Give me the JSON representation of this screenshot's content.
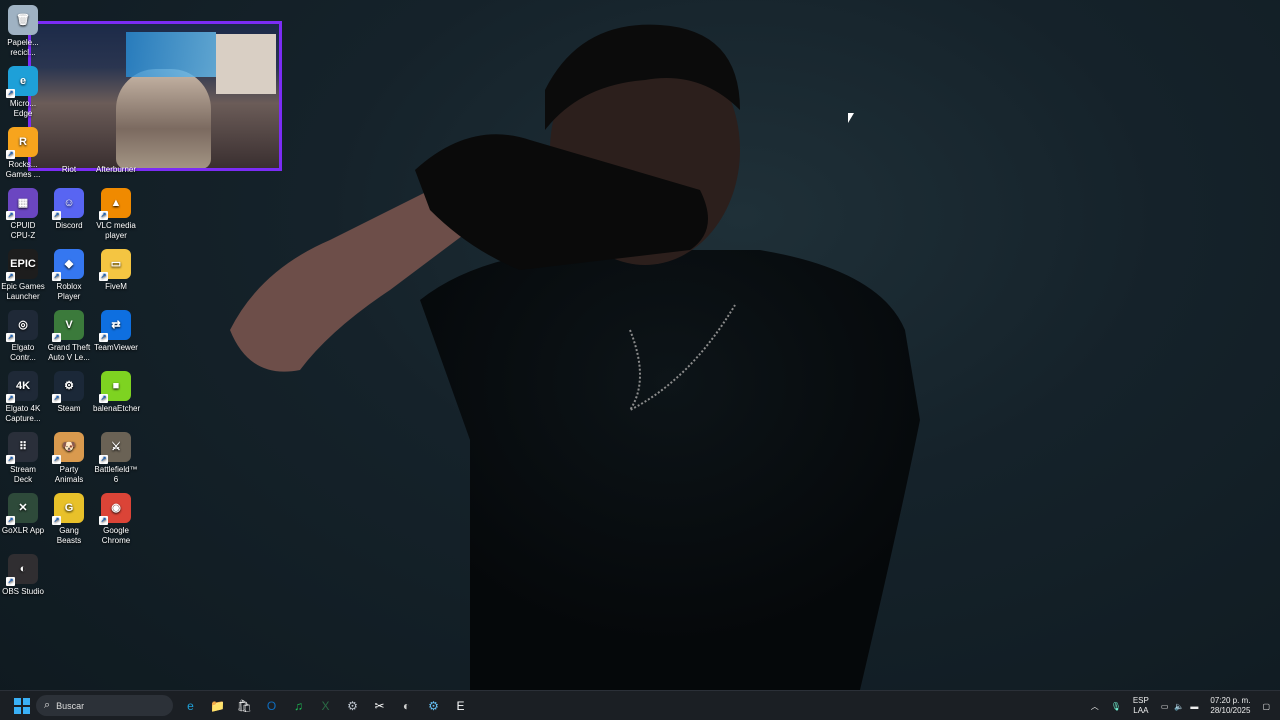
{
  "desktop_icons": [
    {
      "label": "Papelera de reciclaje",
      "display": "Papele... recicl...",
      "icon": "recycle-bin-icon",
      "color": "#9fb2c3"
    },
    {
      "label": "Microsoft Edge",
      "display": "Micro... Edge",
      "icon": "edge-icon",
      "color": "#1ea0d8"
    },
    {
      "label": "Rockstar Games",
      "display": "Rocks... Games ...",
      "icon": "rockstar-icon",
      "color": "#f7a41d"
    },
    {
      "label": "CPUID CPU-Z",
      "display": "CPUID CPU-Z",
      "icon": "cpu-icon",
      "color": "#6b46c1"
    },
    {
      "label": "Discord",
      "display": "Discord",
      "icon": "discord-icon",
      "color": "#5865f2"
    },
    {
      "label": "VLC media player",
      "display": "VLC media player",
      "icon": "vlc-icon",
      "color": "#f08a00"
    },
    {
      "label": "Epic Games Launcher",
      "display": "Epic Games Launcher",
      "icon": "epic-icon",
      "color": "#1d1d1d"
    },
    {
      "label": "Roblox Player",
      "display": "Roblox Player",
      "icon": "roblox-icon",
      "color": "#3577f0"
    },
    {
      "label": "FiveM",
      "display": "FiveM",
      "icon": "folder-icon",
      "color": "#f4c542"
    },
    {
      "label": "Elgato Control Center",
      "display": "Elgato Contr...",
      "icon": "elgato-icon",
      "color": "#1f2937"
    },
    {
      "label": "Grand Theft Auto V Legacy",
      "display": "Grand Theft Auto V Le...",
      "icon": "gta-icon",
      "color": "#3b7a3b"
    },
    {
      "label": "TeamViewer",
      "display": "TeamViewer",
      "icon": "teamviewer-icon",
      "color": "#0e6fe0"
    },
    {
      "label": "Elgato 4K Capture Utility",
      "display": "Elgato 4K Capture...",
      "icon": "4k-icon",
      "color": "#1f2937"
    },
    {
      "label": "Steam",
      "display": "Steam",
      "icon": "steam-icon",
      "color": "#1b2838"
    },
    {
      "label": "balenaEtcher",
      "display": "balenaEtcher",
      "icon": "cube-icon",
      "color": "#7ed321"
    },
    {
      "label": "Stream Deck",
      "display": "Stream Deck",
      "icon": "stream-deck-icon",
      "color": "#2a2f3a"
    },
    {
      "label": "Party Animals",
      "display": "Party Animals",
      "icon": "corgi-icon",
      "color": "#d99a4e"
    },
    {
      "label": "Battlefield 6",
      "display": "Battlefield™ 6",
      "icon": "battlefield-icon",
      "color": "#6a6255"
    },
    {
      "label": "GoXLR App",
      "display": "GoXLR App",
      "icon": "goxlr-icon",
      "color": "#2e4a3a"
    },
    {
      "label": "Gang Beasts",
      "display": "Gang Beasts",
      "icon": "gang-beasts-icon",
      "color": "#e8c12a"
    },
    {
      "label": "Google Chrome",
      "display": "Google Chrome",
      "icon": "chrome-icon",
      "color": "#db4437"
    },
    {
      "label": "OBS Studio",
      "display": "OBS Studio",
      "icon": "obs-icon",
      "color": "#302e31"
    }
  ],
  "partial_labels": {
    "riot": "Riot",
    "afterburner": "Afterburner"
  },
  "taskbar": {
    "search_placeholder": "Buscar",
    "apps": [
      "start-icon",
      "edge-icon",
      "file-explorer-icon",
      "store-icon",
      "outlook-icon",
      "spotify-icon",
      "excel-icon",
      "settings-icon",
      "capcut-icon",
      "obs-icon",
      "steam-icon",
      "epic-icon"
    ],
    "tray": {
      "lang_top": "ESP",
      "lang_bottom": "LAA",
      "time": "07:20 p. m.",
      "date": "28/10/2025"
    }
  },
  "colors": {
    "accent": "#7b2cf5",
    "taskbar_bg": "#1b1f24"
  }
}
